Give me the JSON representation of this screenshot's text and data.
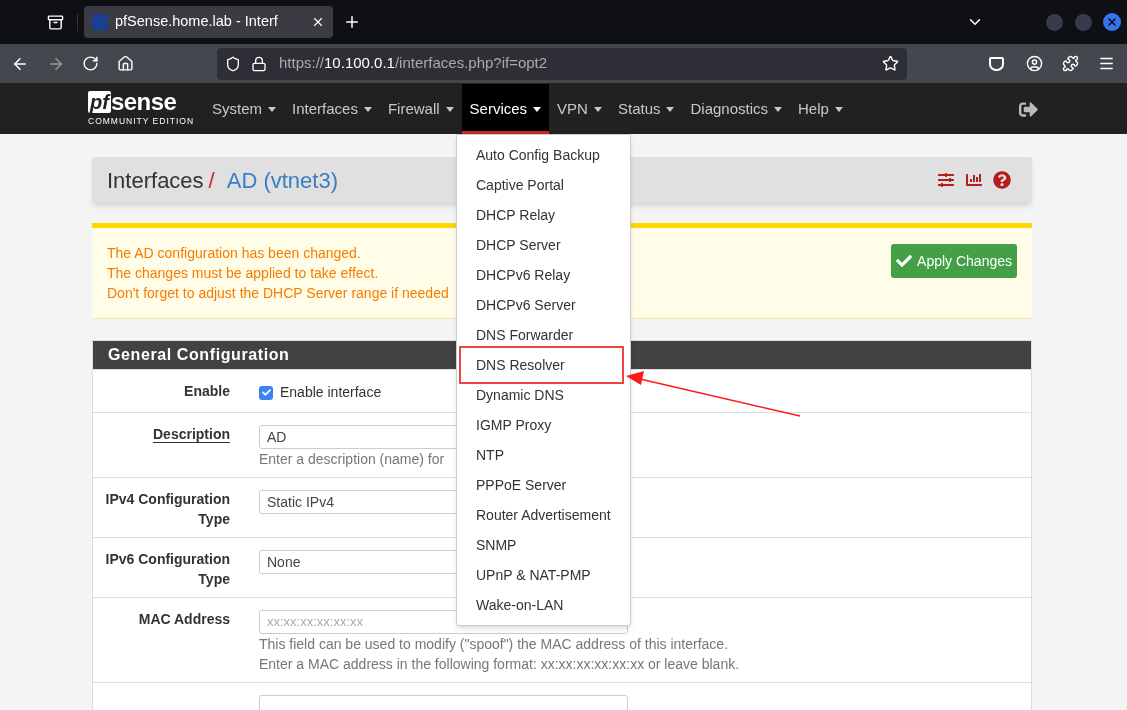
{
  "browser": {
    "tab_title": "pfSense.home.lab - Interf",
    "url": {
      "scheme": "https://",
      "host": "10.100.0.1",
      "path": "/interfaces.php?if=opt2"
    }
  },
  "navbar": {
    "logo": {
      "mark": "pf",
      "word": "sense",
      "edition": "COMMUNITY EDITION"
    },
    "menus": [
      {
        "label": "System",
        "selected": false
      },
      {
        "label": "Interfaces",
        "selected": false
      },
      {
        "label": "Firewall",
        "selected": false
      },
      {
        "label": "Services",
        "selected": true
      },
      {
        "label": "VPN",
        "selected": false
      },
      {
        "label": "Status",
        "selected": false
      },
      {
        "label": "Diagnostics",
        "selected": false
      },
      {
        "label": "Help",
        "selected": false
      }
    ]
  },
  "breadcrumb": {
    "section": "Interfaces",
    "separator": "/",
    "current": "AD (vtnet3)"
  },
  "alert": {
    "lines": [
      "The AD configuration has been changed.",
      "The changes must be applied to take effect.",
      "Don't forget to adjust the DHCP Server range if needed"
    ],
    "button": "Apply Changes"
  },
  "panel": {
    "title": "General Configuration",
    "rows": [
      {
        "kind": "checkbox",
        "label": "Enable",
        "underlined": false,
        "text": "Enable interface",
        "checked": true
      },
      {
        "kind": "input",
        "label": "Description",
        "underlined": true,
        "value": "AD",
        "help": [
          "Enter a description (name) for"
        ]
      },
      {
        "kind": "select",
        "label": "IPv4 Configuration Type",
        "underlined": false,
        "value": "Static IPv4"
      },
      {
        "kind": "select",
        "label": "IPv6 Configuration Type",
        "underlined": false,
        "value": "None"
      },
      {
        "kind": "input",
        "label": "MAC Address",
        "underlined": false,
        "placeholder": "xx:xx:xx:xx:xx:xx",
        "help": [
          "This field can be used to modify (\"spoof\") the MAC address of this interface.",
          "Enter a MAC address in the following format: xx:xx:xx:xx:xx:xx or leave blank."
        ]
      },
      {
        "kind": "input"
      }
    ]
  },
  "dropdown": {
    "items": [
      {
        "label": "Auto Config Backup",
        "annotated": false
      },
      {
        "label": "Captive Portal",
        "annotated": false
      },
      {
        "label": "DHCP Relay",
        "annotated": false
      },
      {
        "label": "DHCP Server",
        "annotated": false
      },
      {
        "label": "DHCPv6 Relay",
        "annotated": false
      },
      {
        "label": "DHCPv6 Server",
        "annotated": false
      },
      {
        "label": "DNS Forwarder",
        "annotated": false
      },
      {
        "label": "DNS Resolver",
        "annotated": true
      },
      {
        "label": "Dynamic DNS",
        "annotated": false
      },
      {
        "label": "IGMP Proxy",
        "annotated": false
      },
      {
        "label": "NTP",
        "annotated": false
      },
      {
        "label": "PPPoE Server",
        "annotated": false
      },
      {
        "label": "Router Advertisement",
        "annotated": false
      },
      {
        "label": "SNMP",
        "annotated": false
      },
      {
        "label": "UPnP & NAT-PMP",
        "annotated": false
      },
      {
        "label": "Wake-on-LAN",
        "annotated": false
      }
    ]
  }
}
